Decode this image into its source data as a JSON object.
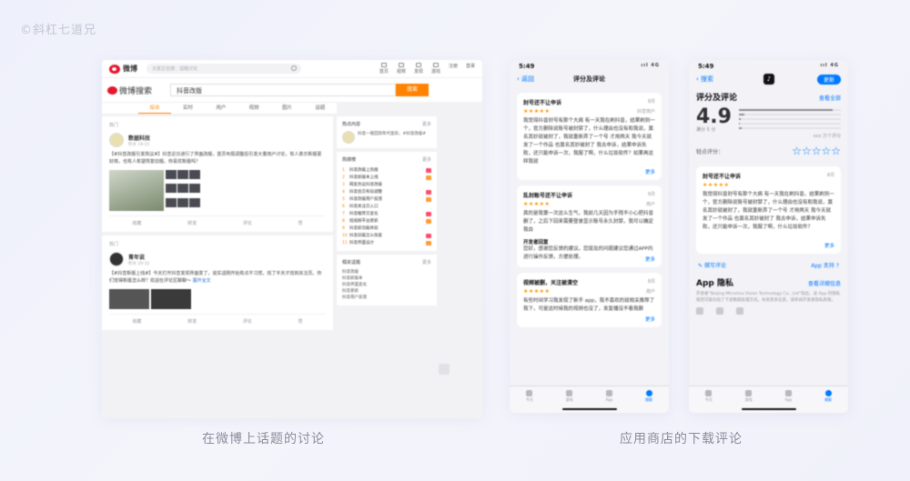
{
  "watermark": "©斜杠七道兄",
  "weibo": {
    "logo": "微博",
    "top_search_placeholder": "大家正在搜：话题讨论",
    "nav": [
      "首页",
      "视频",
      "发现",
      "游戏",
      "注册",
      "登录"
    ],
    "search_logo": "微博搜索",
    "search_value": "抖音改版",
    "search_button": "搜索",
    "tabs": [
      "综合",
      "实时",
      "用户",
      "视频",
      "图片",
      "话题"
    ],
    "posts": [
      {
        "crumb": "热门",
        "author": "数据科技",
        "time": "昨天 19:15",
        "body": "【#抖音改版引发热议#】抖音近日进行了界面改版，首页布局调整后引发大量用户讨论，有人表示新版更好用，也有人希望恢复旧版。你喜欢新版吗？",
        "actions": [
          "收藏",
          "转发",
          "评论",
          "赞"
        ]
      },
      {
        "crumb": "热门",
        "author": "青年说",
        "time": "昨天 20:32",
        "body": "【#抖音新版上线#】今天打开抖音发现界面变了，说实话刚开始有点不习惯，找了半天才找到关注页。你们觉得新版怎么样？欢迎在评论区聊聊～",
        "link": "展开全文",
        "actions": [
          "收藏",
          "转发",
          "评论",
          "赞"
        ]
      }
    ],
    "side": {
      "host_title": "热点内容",
      "host_more": "更多",
      "host_post": "抖音一夜回到年代变形，#抖音改版#",
      "hot_title": "热搜榜",
      "hot_more": "更多",
      "hot_list": [
        "抖音改版上热搜",
        "抖音新版本上线",
        "网友热议抖音改版",
        "抖音首页布局调整",
        "抖音改版用户反馈",
        "抖音关注页入口",
        "抖音推荐页变化",
        "短视频平台更新",
        "抖音新功能体验",
        "抖音旧版怎么恢复",
        "抖音界面设计"
      ],
      "related_title": "相关话题",
      "related_more": "更多",
      "related": [
        "抖音改版",
        "抖音新版本",
        "抖音界面变化",
        "抖音更新",
        "抖音用户反馈"
      ]
    }
  },
  "phone1": {
    "time": "5:49",
    "signal": "ııl 4G",
    "back": "返回",
    "title": "评分及评论",
    "reviews": [
      {
        "title": "封号还不让申诉",
        "date": "8月",
        "user": "抖音用户",
        "stars": "★★★★★",
        "body": "我觉得抖音封号有那个大病 有一天我在刷抖音，结果刷到一个，官方删除说账号被封禁了，什么理由也没有和我说，莫名其妙就被封了，我就重新弄了一个号 才用两天 我今天就发了一个作品 也莫名其妙被封了 我去申诉，结果申诉失败，还只能申诉一次，我服了啊，什么垃圾软件？如果再这样我就"
      },
      {
        "title": "乱封账号还不让申诉",
        "date": "9月",
        "user": "用户",
        "stars": "★★★★★",
        "body": "真的是我第一次这么生气，我前几天因为手残不小心把抖音删了，之后下回来需要登录显示账号永久封禁，我可以确定我自",
        "dev_title": "开发者回复",
        "dev_body": "您好，感谢您反馈的建议。您提及的问题建议您通过APP内进行操作反馈，方便处理。"
      },
      {
        "title": "视频被删，关注被清空",
        "date": "8月",
        "user": "用户",
        "stars": "★★★★★",
        "body": "有些时间学习我发现了新手 app，我不喜欢的就相关推荐了我下，可是这时候我的视频也没了，发复播没不看我删"
      }
    ],
    "more": "更多",
    "tabs": [
      "今天",
      "游戏",
      "App",
      "搜索"
    ]
  },
  "phone2": {
    "time": "5:49",
    "signal": "ııl 4G",
    "back": "搜索",
    "app_icon": "♪",
    "get": "更新",
    "ratings_title": "评分及评论",
    "see_all": "查看全部",
    "score": "4.9",
    "score_max": "满分 5 分",
    "distribution": [
      0.92,
      0.05,
      0.02,
      0.01,
      0.03
    ],
    "ratings_count": "xxx 万个评分",
    "tap_to_rate": "轻点评分：",
    "tap_stars": "☆☆☆☆☆",
    "review": {
      "title": "封号还不让申诉",
      "date": "8月",
      "stars": "★★★★★",
      "body": "我觉得抖音封号有那个大病 有一天我在刷抖音，结果刷到一个，官方删除说账号被封禁了，什么理由也没有和我说，莫名其妙就被封了，我就重新弄了一个号 才用两天 我今天就发了一个作品 也莫名其妙被封了 我去申诉，结果申诉失败，还只能申诉一次，我服了啊，什么垃圾软件？"
    },
    "write_review": "撰写评论",
    "app_support": "App 支持",
    "privacy_title": "App 隐私",
    "privacy_link": "查看详细信息",
    "privacy_text": "开发者“Beijing Microlive Vision Technology Co., Ltd”指出，该 App 的隐私规范可能包括了下述数据处理方式。有关更多信息，请参阅开发者隐私政策。",
    "more": "更多",
    "tabs": [
      "今天",
      "游戏",
      "App",
      "搜索"
    ]
  },
  "captions": {
    "left": "在微博上话题的讨论",
    "right": "应用商店的下载评论"
  }
}
